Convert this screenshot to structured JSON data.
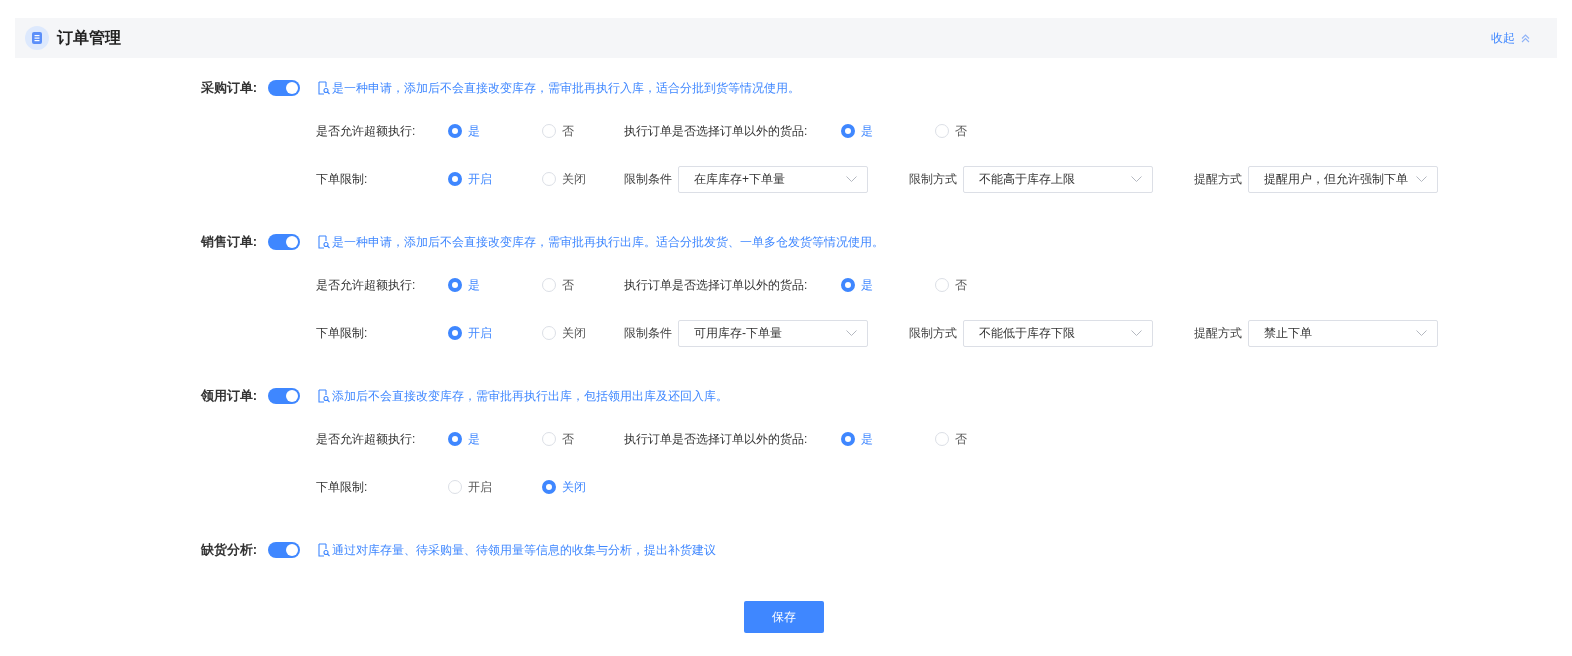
{
  "panel": {
    "title": "订单管理",
    "collapse_link": "收起"
  },
  "sections": [
    {
      "label": "采购订单:",
      "enabled": true,
      "description": "是一种申请，添加后不会直接改变库存，需审批再执行入库，适合分批到货等情况使用。",
      "rows": [
        [
          {
            "kind": "radio",
            "label": "是否允许超额执行:",
            "options": [
              {
                "label": "是",
                "selected": true
              },
              {
                "label": "否",
                "selected": false
              }
            ]
          },
          {
            "kind": "radio",
            "label": "执行订单是否选择订单以外的货品:",
            "options": [
              {
                "label": "是",
                "selected": true
              },
              {
                "label": "否",
                "selected": false
              }
            ]
          }
        ],
        [
          {
            "kind": "radio",
            "label": "下单限制:",
            "options": [
              {
                "label": "开启",
                "selected": true
              },
              {
                "label": "关闭",
                "selected": false
              }
            ]
          },
          {
            "kind": "select",
            "label": "限制条件",
            "value": "在库库存+下单量"
          },
          {
            "kind": "select",
            "label": "限制方式",
            "value": "不能高于库存上限"
          },
          {
            "kind": "select",
            "label": "提醒方式",
            "value": "提醒用户，但允许强制下单"
          }
        ]
      ]
    },
    {
      "label": "销售订单:",
      "enabled": true,
      "description": "是一种申请，添加后不会直接改变库存，需审批再执行出库。适合分批发货、一单多仓发货等情况使用。",
      "rows": [
        [
          {
            "kind": "radio",
            "label": "是否允许超额执行:",
            "options": [
              {
                "label": "是",
                "selected": true
              },
              {
                "label": "否",
                "selected": false
              }
            ]
          },
          {
            "kind": "radio",
            "label": "执行订单是否选择订单以外的货品:",
            "options": [
              {
                "label": "是",
                "selected": true
              },
              {
                "label": "否",
                "selected": false
              }
            ]
          }
        ],
        [
          {
            "kind": "radio",
            "label": "下单限制:",
            "options": [
              {
                "label": "开启",
                "selected": true
              },
              {
                "label": "关闭",
                "selected": false
              }
            ]
          },
          {
            "kind": "select",
            "label": "限制条件",
            "value": "可用库存-下单量"
          },
          {
            "kind": "select",
            "label": "限制方式",
            "value": "不能低于库存下限"
          },
          {
            "kind": "select",
            "label": "提醒方式",
            "value": "禁止下单"
          }
        ]
      ]
    },
    {
      "label": "领用订单:",
      "enabled": true,
      "description": "添加后不会直接改变库存，需审批再执行出库，包括领用出库及还回入库。",
      "rows": [
        [
          {
            "kind": "radio",
            "label": "是否允许超额执行:",
            "options": [
              {
                "label": "是",
                "selected": true
              },
              {
                "label": "否",
                "selected": false
              }
            ]
          },
          {
            "kind": "radio",
            "label": "执行订单是否选择订单以外的货品:",
            "options": [
              {
                "label": "是",
                "selected": true
              },
              {
                "label": "否",
                "selected": false
              }
            ]
          }
        ],
        [
          {
            "kind": "radio",
            "label": "下单限制:",
            "options": [
              {
                "label": "开启",
                "selected": false
              },
              {
                "label": "关闭",
                "selected": true
              }
            ]
          }
        ]
      ]
    },
    {
      "label": "缺货分析:",
      "enabled": true,
      "description": "通过对库存量、待采购量、待领用量等信息的收集与分析，提出补货建议"
    }
  ],
  "save_button": "保存"
}
